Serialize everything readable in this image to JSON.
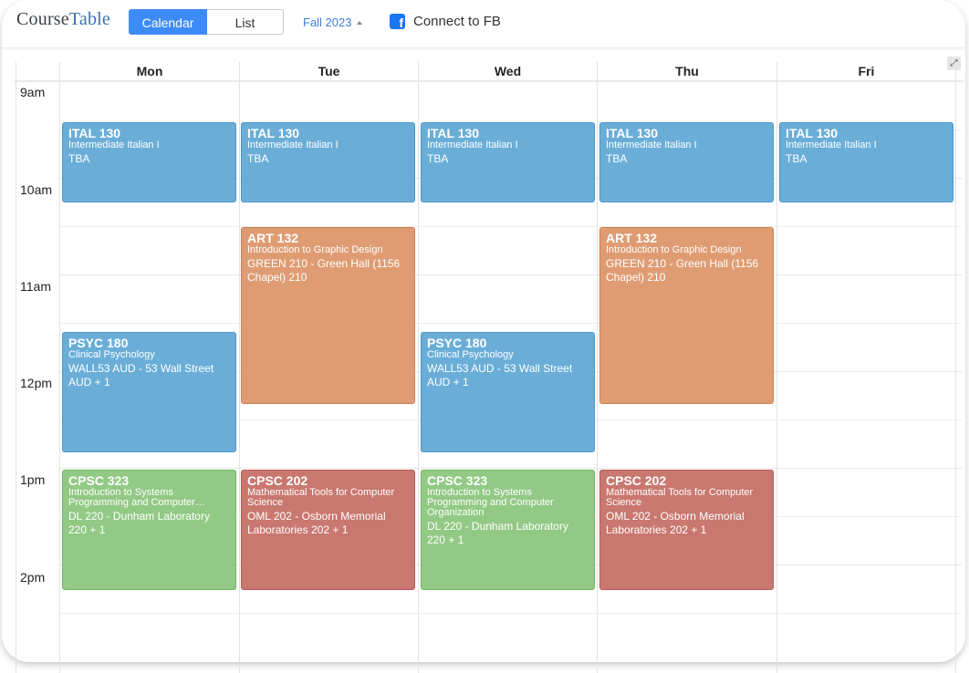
{
  "app": {
    "logo_course": "Course",
    "logo_table": "Table"
  },
  "toolbar": {
    "calendar_label": "Calendar",
    "list_label": "List",
    "season": "Fall 2023",
    "fb_label": "Connect to FB"
  },
  "days": [
    "Mon",
    "Tue",
    "Wed",
    "Thu",
    "Fri"
  ],
  "times": [
    "9am",
    "10am",
    "11am",
    "12pm",
    "1pm",
    "2pm"
  ],
  "events": {
    "ital": {
      "code": "ITAL 130",
      "name": "Intermediate Italian I",
      "loc": "TBA"
    },
    "art": {
      "code": "ART 132",
      "name": "Introduction to Graphic Design",
      "loc": "GREEN 210 - Green Hall (1156 Chapel) 210"
    },
    "psyc": {
      "code": "PSYC 180",
      "name": "Clinical Psychology",
      "loc": "WALL53 AUD - 53 Wall Street AUD + 1"
    },
    "cpsc323_mon": {
      "code": "CPSC 323",
      "name": "Introduction to Systems Programming and Computer…",
      "loc": "DL 220 - Dunham Laboratory 220 + 1"
    },
    "cpsc323_wed": {
      "code": "CPSC 323",
      "name": "Introduction to Systems Programming and Computer Organization",
      "loc": "DL 220 - Dunham Laboratory 220 + 1"
    },
    "cpsc202": {
      "code": "CPSC 202",
      "name": "Mathematical Tools for Computer Science",
      "loc": "OML 202 - Osborn Memorial Laboratories 202 + 1"
    }
  },
  "colors": {
    "blue": "#6aaed8",
    "orange": "#df9c73",
    "green": "#92c985",
    "red": "#c97870",
    "accent": "#3d8bf7"
  }
}
